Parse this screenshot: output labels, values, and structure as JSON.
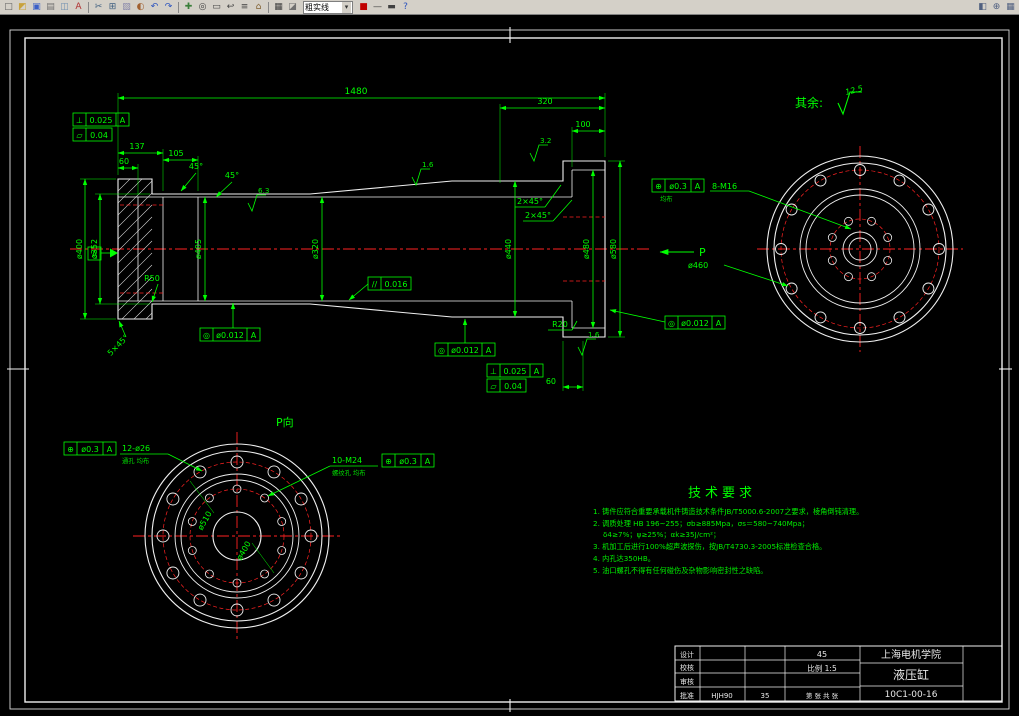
{
  "toolbar": {
    "layer_combo": "粗实线",
    "icons": [
      {
        "n": "new-file",
        "g": "□"
      },
      {
        "n": "open-file",
        "g": "◩"
      },
      {
        "n": "save-file",
        "g": "▣"
      },
      {
        "n": "plot",
        "g": "▤"
      },
      {
        "n": "print-preview",
        "g": "◫"
      },
      {
        "n": "spell-check",
        "g": "A"
      },
      {
        "n": "cut",
        "g": "✂"
      },
      {
        "n": "copy",
        "g": "⊞"
      },
      {
        "n": "paste",
        "g": "▧"
      },
      {
        "n": "match-properties",
        "g": "◐"
      },
      {
        "n": "undo",
        "g": "↶"
      },
      {
        "n": "redo",
        "g": "↷"
      },
      {
        "n": "pan",
        "g": "✚"
      },
      {
        "n": "zoom-realtime",
        "g": "◎"
      },
      {
        "n": "zoom-window",
        "g": "▭"
      },
      {
        "n": "zoom-previous",
        "g": "↩"
      },
      {
        "n": "properties",
        "g": "≡"
      },
      {
        "n": "design-center",
        "g": "⌂"
      },
      {
        "n": "layers",
        "g": "▦"
      },
      {
        "n": "layer-states",
        "g": "◪"
      },
      {
        "n": "color-control",
        "g": "■"
      },
      {
        "n": "linetype-control",
        "g": "—"
      },
      {
        "n": "lineweight-control",
        "g": "▬"
      },
      {
        "n": "help",
        "g": "?"
      },
      {
        "n": "model-space",
        "g": "◧"
      },
      {
        "n": "osnap",
        "g": "⊕"
      },
      {
        "n": "grid",
        "g": "▦"
      }
    ]
  },
  "main_view": {
    "dims": {
      "overall": "1480",
      "l320": "320",
      "l100": "100",
      "l137": "137",
      "l105": "105",
      "l60": "60",
      "l60b": "60",
      "d400": "ø400",
      "d352": "ø352",
      "d405": "ø405",
      "d320": "ø320",
      "d440": "ø440",
      "d480": "ø480",
      "d580": "ø580",
      "r50": "R50",
      "r20": "R20",
      "c45a": "45°",
      "c45b": "45°",
      "c2x45a": "2×45°",
      "c2x45b": "2×45°",
      "c5x45": "5×45°",
      "sf1": "6.3",
      "sf2": "1.6",
      "sf3": "3.2",
      "sf4": "1.6",
      "datum": "A"
    }
  },
  "fcf": [
    {
      "sym": "⊥",
      "val": "0.025",
      "datum": "A"
    },
    {
      "sym": "▱",
      "val": "0.04"
    },
    {
      "sym": "◎",
      "val": "ø0.012",
      "datum": "A"
    },
    {
      "sym": "//",
      "val": "0.016"
    },
    {
      "sym": "◎",
      "val": "ø0.012",
      "datum": "A"
    },
    {
      "sym": "◎",
      "val": "ø0.012",
      "datum": "A"
    },
    {
      "sym": "⊥",
      "val": "0.025",
      "datum": "A"
    },
    {
      "sym": "▱",
      "val": "0.04"
    },
    {
      "sym": "⊕",
      "val": "ø0.3",
      "datum": "A"
    },
    {
      "sym": "⊕",
      "val": "ø0.3",
      "datum": "A"
    },
    {
      "sym": "⊕",
      "val": "ø0.3",
      "datum": "A"
    }
  ],
  "right_view": {
    "bolt_label": "8-M16",
    "bolt_note": "均布",
    "d460": "ø460",
    "p": "P",
    "surplus": "其余:",
    "surplus_val": "12.5"
  },
  "bottom_view": {
    "title": "P向",
    "holes12": "12-ø26",
    "holes12_note": "通孔 均布",
    "holes10": "10-M24",
    "holes10_note": "螺纹孔 均布",
    "d510": "ø510",
    "d400": "ø400"
  },
  "tech": {
    "title": "技术要求",
    "lines": [
      "1. 铸件应符合重要承载机件铸造技术条件JB/T5000.6-2007之要求，棱角倒钝清理。",
      "2. 调质处理 HB 196~255；σb≥885Mpa，σs＝580~740Mpa；",
      "δ4≥7%；ψ≥25%；αk≥35J/cm²；",
      "3. 机加工后进行100%超声波探伤，按JB/T4730.3-2005标准检查合格。",
      "4. 内孔达350HB。",
      "5. 油口螺孔不得有任何碰伤及杂物影响密封性之缺陷。"
    ]
  },
  "titleblock": {
    "rows": {
      "design": "设计",
      "check": "校核",
      "audit": "审核",
      "approve": "批准"
    },
    "material": "45",
    "org": "上海电机学院",
    "scale": "比例 1:5",
    "part": "液压缸",
    "code": "HJH90",
    "weight": "35",
    "sheet": "第 张 共 张",
    "dwg_no": "10C1-00-16"
  }
}
